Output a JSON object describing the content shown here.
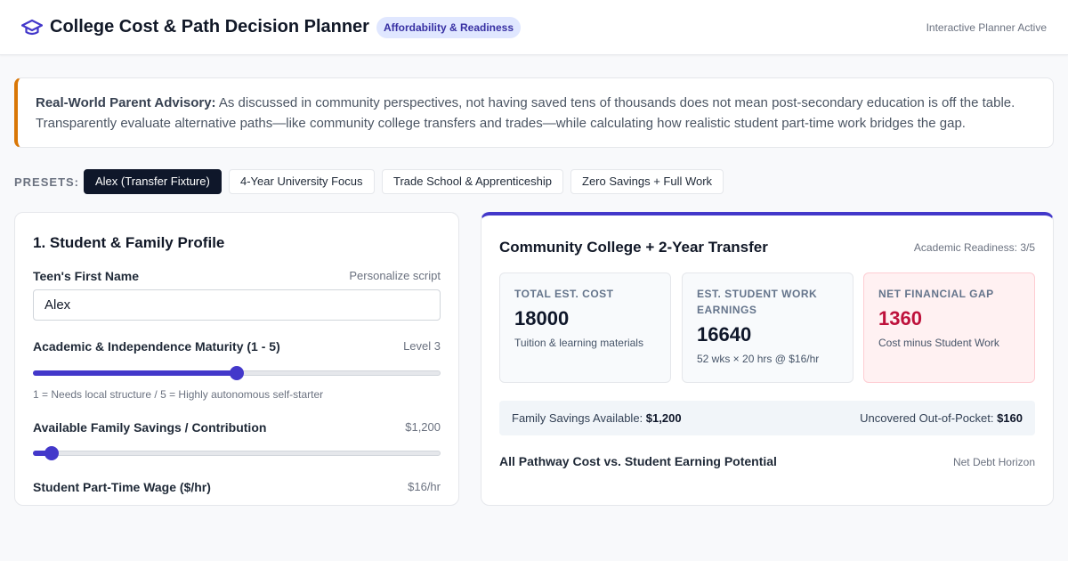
{
  "header": {
    "title": "College Cost & Path Decision Planner",
    "badge": "Affordability & Readiness",
    "status": "Interactive Planner Active",
    "logo_icon": "graduation-cap-icon"
  },
  "advisory": {
    "lead": "Real-World Parent Advisory:",
    "text": " As discussed in community perspectives, not having saved tens of thousands does not mean post-secondary education is off the table. Transparently evaluate alternative paths—like community college transfers and trades—while calculating how realistic student part-time work bridges the gap."
  },
  "presets": {
    "label": "PRESETS:",
    "items": [
      {
        "label": "Alex (Transfer Fixture)",
        "active": true
      },
      {
        "label": "4-Year University Focus",
        "active": false
      },
      {
        "label": "Trade School & Apprenticeship",
        "active": false
      },
      {
        "label": "Zero Savings + Full Work",
        "active": false
      }
    ]
  },
  "profile": {
    "title": "1. Student & Family Profile",
    "name_label": "Teen's First Name",
    "name_hint": "Personalize script",
    "name_value": "Alex",
    "maturity_label": "Academic & Independence Maturity (1 - 5)",
    "maturity_value_text": "Level 3",
    "maturity_value": 3,
    "maturity_min": 1,
    "maturity_max": 5,
    "maturity_hint": "1 = Needs local structure / 5 = Highly autonomous self-starter",
    "savings_label": "Available Family Savings / Contribution",
    "savings_value_text": "$1,200",
    "savings_fraction": 0.045,
    "wage_label": "Student Part-Time Wage ($/hr)",
    "wage_value_text": "$16/hr"
  },
  "results": {
    "path_title": "Community College + 2-Year Transfer",
    "readiness": "Academic Readiness: 3/5",
    "stats": [
      {
        "label": "Total Est. Cost",
        "value": "18000",
        "sub": "Tuition & learning materials",
        "alert": false
      },
      {
        "label": "Est. Student Work Earnings",
        "value": "16640",
        "sub": "52 wks × 20 hrs @ $16/hr",
        "alert": false
      },
      {
        "label": "Net Financial Gap",
        "value": "1360",
        "sub": "Cost minus Student Work",
        "alert": true
      }
    ],
    "savings_label": "Family Savings Available: ",
    "savings_value": "$1,200",
    "uncovered_label": "Uncovered Out-of-Pocket: ",
    "uncovered_value": "$160",
    "chart_title": "All Pathway Cost vs. Student Earning Potential",
    "chart_hint": "Net Debt Horizon"
  },
  "colors": {
    "accent": "#4338ca",
    "advisory_border": "#d97706",
    "alert": "#be123c"
  }
}
